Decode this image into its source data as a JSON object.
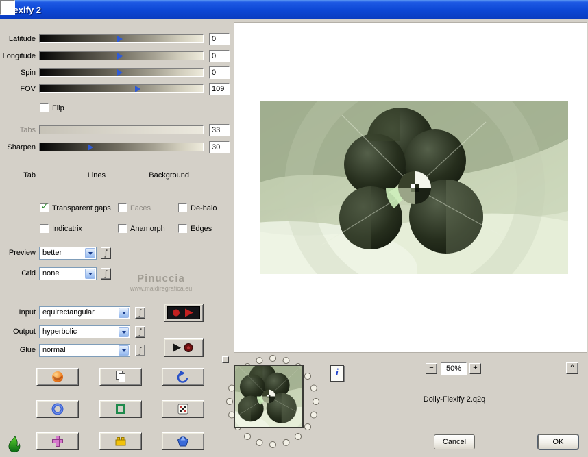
{
  "window": {
    "title": "Flexify 2"
  },
  "left": {
    "sliders": [
      {
        "label": "Latitude",
        "value": "0",
        "thumb": "left:49%"
      },
      {
        "label": "Longitude",
        "value": "0",
        "thumb": "left:49%"
      },
      {
        "label": "Spin",
        "value": "0",
        "thumb": "left:49%"
      },
      {
        "label": "FOV",
        "value": "109",
        "thumb": "left:60%"
      },
      {
        "label": "Tabs",
        "value": "33",
        "thumb": ""
      },
      {
        "label": "Sharpen",
        "value": "30",
        "thumb": "left:31%"
      }
    ],
    "flip_label": "Flip",
    "swatches": [
      {
        "label": "Tab",
        "css": "background:#e9bcdf"
      },
      {
        "label": "Lines",
        "css": "background:#000000"
      },
      {
        "label": "Background",
        "css": "background:#ffffff"
      }
    ],
    "checks": [
      {
        "label": "Transparent gaps",
        "mark": "✓"
      },
      {
        "label": "Faces",
        "mark": ""
      },
      {
        "label": "De-halo",
        "mark": ""
      },
      {
        "label": "Indicatrix",
        "mark": ""
      },
      {
        "label": "Anamorph",
        "mark": ""
      },
      {
        "label": "Edges",
        "mark": ""
      }
    ],
    "selects": [
      {
        "label": "Preview",
        "value": "better"
      },
      {
        "label": "Grid",
        "value": "none"
      },
      {
        "label": "Input",
        "value": "equirectangular"
      },
      {
        "label": "Output",
        "value": "hyperbolic"
      },
      {
        "label": "Glue",
        "value": "normal"
      }
    ],
    "random_glyph": "ʃ"
  },
  "watermark": {
    "name": "Pinuccia",
    "url": "www.maidiregrafica.eu"
  },
  "footer": {
    "info_label": "i",
    "zoom_out": "−",
    "zoom_value": "50%",
    "zoom_in": "+",
    "collapse": "^",
    "filename": "Dolly-Flexify 2.q2q",
    "cancel_label": "Cancel",
    "ok_label": "OK"
  },
  "accent_colors": {
    "title_blue": "#0c46d4",
    "check_green": "#2c8a2c",
    "thumb_blue": "#2f5bd6"
  }
}
